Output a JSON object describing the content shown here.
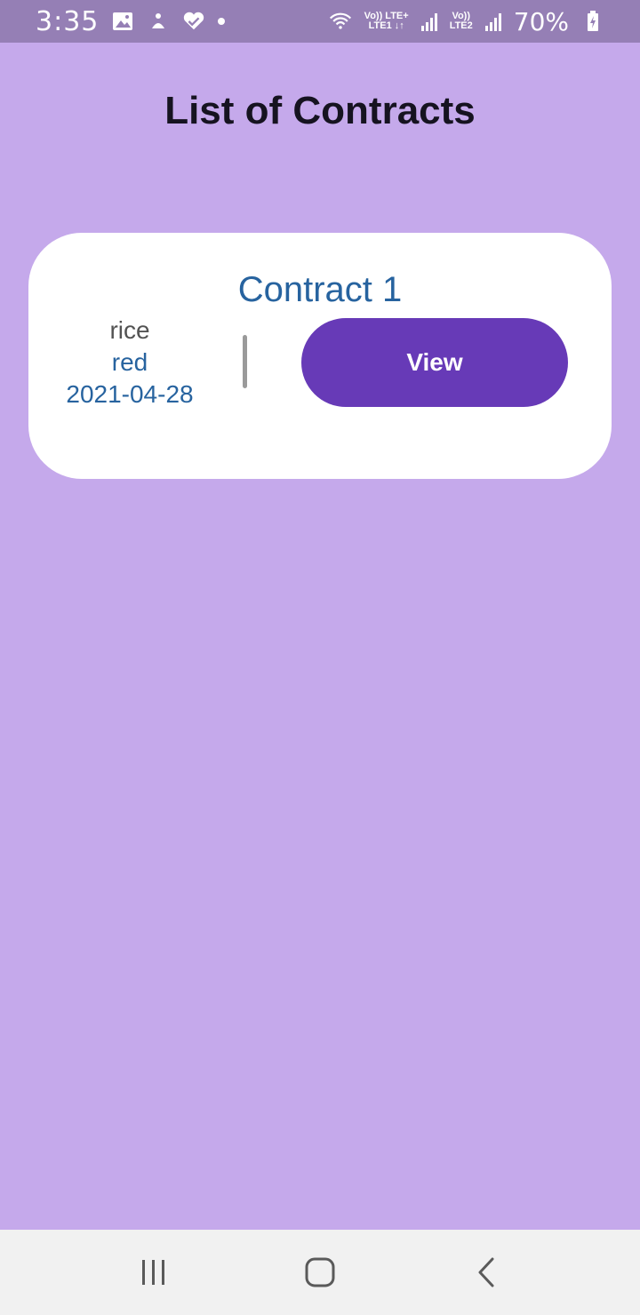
{
  "status_bar": {
    "time": "3:35",
    "icons": [
      "gallery-icon",
      "app-icon",
      "health-icon",
      "notification-dot-icon",
      "wifi-icon",
      "signal-icon",
      "battery-icon"
    ],
    "network1_line1": "Vo)) LTE+",
    "network1_line2": "LTE1 ↓↑",
    "network2_line1": "Vo))",
    "network2_line2": "LTE2",
    "battery": "70%"
  },
  "header": {
    "title": "List of Contracts"
  },
  "contracts": [
    {
      "title": "Contract 1",
      "item": "rice",
      "color": "red",
      "date": "2021-04-28",
      "button_label": "View"
    }
  ],
  "nav_bar": {
    "icons": [
      "recent-apps-icon",
      "home-icon",
      "back-icon"
    ]
  },
  "colors": {
    "background": "#c5a9eb",
    "status_bar": "#957fb5",
    "card": "#ffffff",
    "accent": "#673ab7",
    "link_text": "#27639f"
  }
}
